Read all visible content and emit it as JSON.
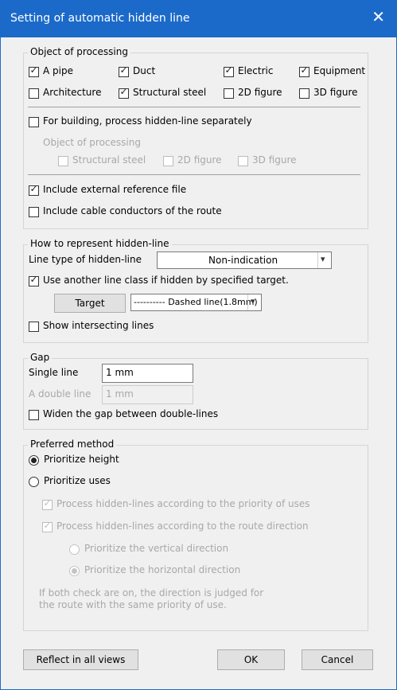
{
  "title": "Setting of automatic hidden line",
  "object_group": {
    "title": "Object of processing",
    "items": [
      {
        "label": "A pipe",
        "checked": true
      },
      {
        "label": "Duct",
        "checked": true
      },
      {
        "label": "Electric",
        "checked": true
      },
      {
        "label": "Equipment",
        "checked": true
      },
      {
        "label": "Architecture",
        "checked": false
      },
      {
        "label": "Structural steel",
        "checked": true
      },
      {
        "label": "2D figure",
        "checked": false
      },
      {
        "label": "3D figure",
        "checked": false
      }
    ],
    "building_label": "For building, process hidden-line separately",
    "sub_title": "Object of processing",
    "sub_items": [
      {
        "label": "Structural steel"
      },
      {
        "label": "2D figure"
      },
      {
        "label": "3D figure"
      }
    ],
    "ext_ref_label": "Include external reference file",
    "cable_label": "Include cable conductors of the route"
  },
  "represent_group": {
    "title": "How to represent hidden-line",
    "line_type_label": "Line type of hidden-line",
    "line_type_value": "Non-indication",
    "another_class_label": "Use another line class if hidden by specified target.",
    "target_button": "Target",
    "dashed_value": "---------- Dashed line(1.8mm)",
    "intersect_label": "Show intersecting lines"
  },
  "gap_group": {
    "title": "Gap",
    "single_label": "Single line",
    "single_value": "1 mm",
    "double_label": "A double line",
    "double_value": "1 mm",
    "widen_label": "Widen the gap between double-lines"
  },
  "preferred_group": {
    "title": "Preferred method",
    "height_label": "Prioritize height",
    "uses_label": "Prioritize uses",
    "proc_priority_label": "Process hidden-lines according to the priority of uses",
    "proc_route_label": "Process hidden-lines according to the route direction",
    "vertical_label": "Prioritize the vertical direction",
    "horizontal_label": "Prioritize the horizontal direction",
    "note": "If both check are on, the direction is judged for\nthe route with the same priority of use."
  },
  "buttons": {
    "reflect": "Reflect in all views",
    "ok": "OK",
    "cancel": "Cancel"
  }
}
